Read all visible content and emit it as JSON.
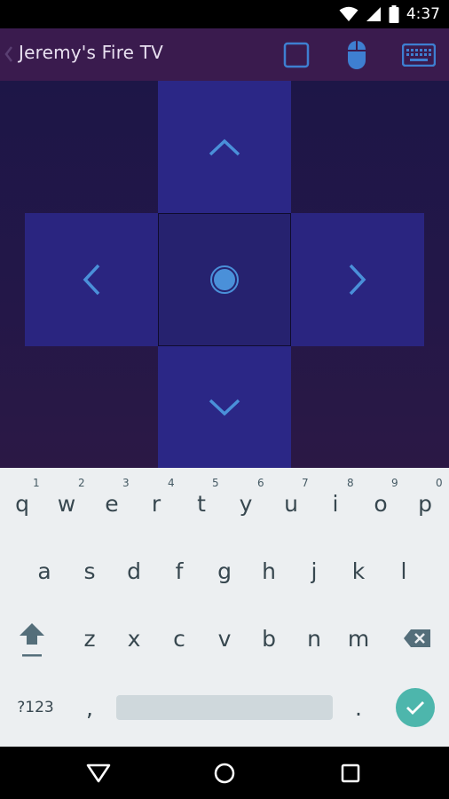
{
  "status_bar": {
    "time": "4:37",
    "icons": [
      "wifi-icon",
      "cell-signal-icon",
      "battery-icon"
    ]
  },
  "app_bar": {
    "title": "Jeremy's Fire TV",
    "actions": [
      "dpad-mode-icon",
      "mouse-icon",
      "keyboard-icon"
    ],
    "accent": "#3e7fd1",
    "background": "#3a1b4e"
  },
  "dpad": {
    "buttons": [
      "up",
      "left",
      "select",
      "right",
      "down"
    ],
    "arrow_color": "#4a90d9"
  },
  "keyboard": {
    "row1": [
      {
        "key": "q",
        "hint": "1"
      },
      {
        "key": "w",
        "hint": "2"
      },
      {
        "key": "e",
        "hint": "3"
      },
      {
        "key": "r",
        "hint": "4"
      },
      {
        "key": "t",
        "hint": "5"
      },
      {
        "key": "y",
        "hint": "6"
      },
      {
        "key": "u",
        "hint": "7"
      },
      {
        "key": "i",
        "hint": "8"
      },
      {
        "key": "o",
        "hint": "9"
      },
      {
        "key": "p",
        "hint": "0"
      }
    ],
    "row2": [
      "a",
      "s",
      "d",
      "f",
      "g",
      "h",
      "j",
      "k",
      "l"
    ],
    "row3": [
      "z",
      "x",
      "c",
      "v",
      "b",
      "n",
      "m"
    ],
    "symbols_label": "?123",
    "comma": ",",
    "period": ".",
    "enter_color": "#4db6ac"
  },
  "nav_bar": {
    "buttons": [
      "back-icon",
      "home-icon",
      "recents-icon"
    ]
  }
}
